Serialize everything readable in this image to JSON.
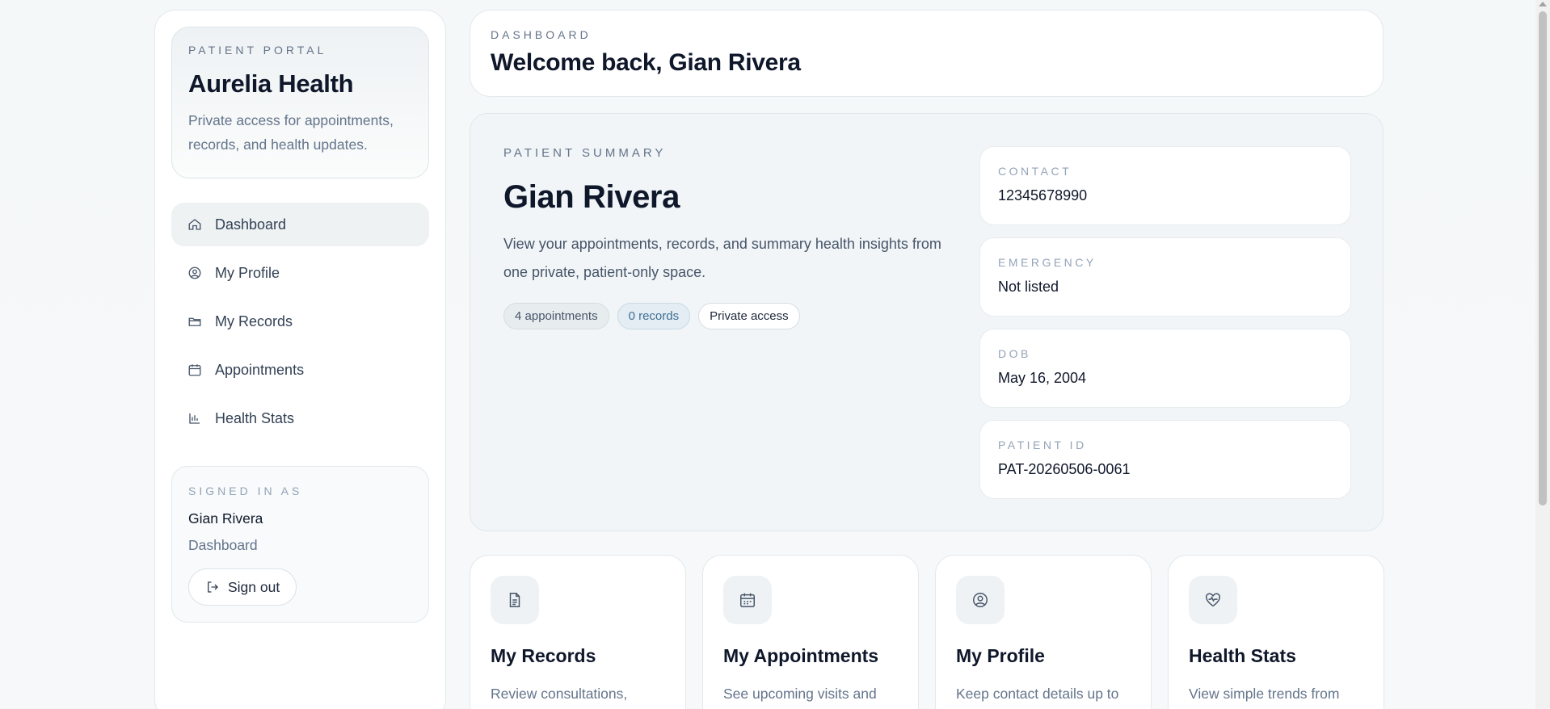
{
  "sidebar": {
    "brand": {
      "kicker": "PATIENT PORTAL",
      "title": "Aurelia Health",
      "description": "Private access for appointments, records, and health updates."
    },
    "nav": [
      {
        "label": "Dashboard",
        "icon": "home-icon",
        "active": true
      },
      {
        "label": "My Profile",
        "icon": "user-circle-icon",
        "active": false
      },
      {
        "label": "My Records",
        "icon": "folder-icon",
        "active": false
      },
      {
        "label": "Appointments",
        "icon": "calendar-icon",
        "active": false
      },
      {
        "label": "Health Stats",
        "icon": "bar-chart-icon",
        "active": false
      }
    ],
    "signed_in": {
      "kicker": "SIGNED IN AS",
      "name": "Gian Rivera",
      "page": "Dashboard",
      "signout_label": "Sign out"
    }
  },
  "header": {
    "kicker": "DASHBOARD",
    "title": "Welcome back, Gian Rivera"
  },
  "summary": {
    "kicker": "PATIENT SUMMARY",
    "name": "Gian Rivera",
    "description": "View your appointments, records, and summary health insights from one private, patient-only space.",
    "chips": [
      "4 appointments",
      "0 records",
      "Private access"
    ],
    "info": [
      {
        "label": "CONTACT",
        "value": "12345678990"
      },
      {
        "label": "EMERGENCY",
        "value": "Not listed"
      },
      {
        "label": "DOB",
        "value": "May 16, 2004"
      },
      {
        "label": "PATIENT ID",
        "value": "PAT-20260506-0061"
      }
    ]
  },
  "cards": [
    {
      "title": "My Records",
      "description": "Review consultations,",
      "icon": "document-icon"
    },
    {
      "title": "My Appointments",
      "description": "See upcoming visits and",
      "icon": "calendar-icon"
    },
    {
      "title": "My Profile",
      "description": "Keep contact details up to",
      "icon": "user-circle-icon"
    },
    {
      "title": "Health Stats",
      "description": "View simple trends from",
      "icon": "heart-pulse-icon"
    }
  ],
  "colors": {
    "accent_chip": "#3f6e95",
    "nav_active_bg": "#eef2f3",
    "text_primary": "#0f172a",
    "text_muted": "#64748b"
  }
}
